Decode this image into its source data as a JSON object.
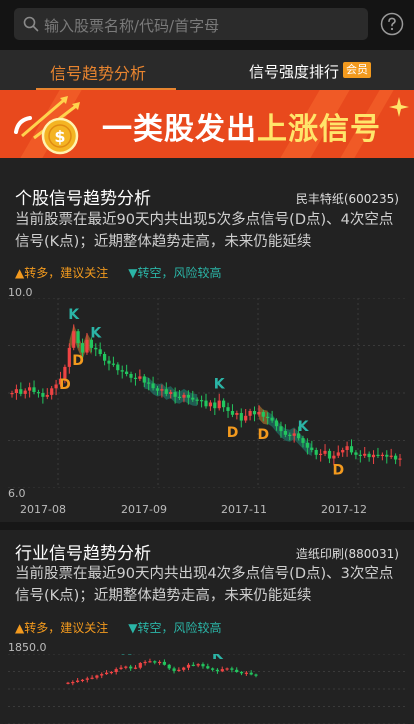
{
  "search": {
    "placeholder": "输入股票名称/代码/首字母",
    "icon": "search-icon"
  },
  "help_icon": "question-circle-icon",
  "tabs": [
    {
      "label": "信号趋势分析",
      "active": true
    },
    {
      "label": "信号强度排行",
      "badge": "会员"
    }
  ],
  "banner": {
    "text_white": "一类股发出",
    "text_highlight": "上涨信号"
  },
  "legend": {
    "up": "转多，建议关注",
    "down": "转空，风险较高"
  },
  "colors": {
    "accent": "#e8842f",
    "bull": "#ef4444",
    "bear": "#22c55e",
    "trend_up": "#c8842f",
    "trend_down": "#1f8a7a",
    "signal_k": "#2bb5a7",
    "signal_d": "#f39a1e"
  },
  "stock_section": {
    "title": "个股信号趋势分析",
    "stock": "民丰特纸(600235)",
    "desc": "当前股票在最近90天内共出现5次多点信号(D点)、4次空点信号(K点)；近期整体趋势走高，未来仍能延续",
    "y_top": "10.0",
    "y_bottom": "6.0",
    "x_labels": [
      "2017-08",
      "2017-09",
      "2017-11",
      "2017-12"
    ]
  },
  "industry_section": {
    "title": "行业信号趋势分析",
    "stock": "造纸印刷(880031)",
    "desc": "当前股票在最近90天内共出现4次多点信号(D点)、3次空点信号(K点)；近期整体趋势走高，未来仍能延续",
    "y_top": "1850.0"
  },
  "chart_data": [
    {
      "type": "candlestick",
      "title": "个股信号趋势分析",
      "ylim": [
        6.0,
        10.0
      ],
      "x_tick_labels": [
        "2017-08",
        "2017-09",
        "2017-11",
        "2017-12"
      ],
      "closes": [
        8.0,
        8.08,
        7.98,
        8.05,
        8.12,
        8.02,
        8.0,
        7.92,
        7.96,
        8.1,
        8.18,
        8.3,
        8.55,
        8.95,
        9.3,
        9.05,
        8.85,
        9.12,
        8.95,
        8.92,
        8.82,
        8.68,
        8.62,
        8.6,
        8.48,
        8.45,
        8.4,
        8.32,
        8.3,
        8.35,
        8.22,
        8.2,
        8.1,
        8.05,
        8.08,
        7.98,
        8.02,
        7.92,
        7.9,
        7.96,
        7.9,
        7.86,
        7.85,
        7.84,
        7.72,
        7.8,
        7.68,
        7.84,
        7.7,
        7.62,
        7.54,
        7.58,
        7.42,
        7.52,
        7.62,
        7.55,
        7.6,
        7.5,
        7.48,
        7.42,
        7.3,
        7.2,
        7.12,
        7.1,
        7.15,
        7.05,
        6.95,
        6.85,
        6.8,
        6.7,
        6.72,
        6.78,
        6.62,
        6.68,
        6.75,
        6.8,
        6.88,
        6.75,
        6.7,
        6.68,
        6.72,
        6.65,
        6.7,
        6.68,
        6.7,
        6.66,
        6.68,
        6.6,
        6.62
      ],
      "signals": [
        {
          "type": "D",
          "index": 12
        },
        {
          "type": "K",
          "index": 14
        },
        {
          "type": "D",
          "index": 15
        },
        {
          "type": "K",
          "index": 19
        },
        {
          "type": "K",
          "index": 47
        },
        {
          "type": "D",
          "index": 50
        },
        {
          "type": "D",
          "index": 57
        },
        {
          "type": "K",
          "index": 66
        },
        {
          "type": "D",
          "index": 74
        }
      ],
      "trend_bands": [
        {
          "direction": "up",
          "from": 13,
          "to": 18
        },
        {
          "direction": "down",
          "from": 30,
          "to": 42
        },
        {
          "direction": "up",
          "from": 56,
          "to": 58
        },
        {
          "direction": "down",
          "from": 58,
          "to": 68
        }
      ]
    },
    {
      "type": "candlestick",
      "title": "行业信号趋势分析",
      "ylim_top": 1850.0,
      "closes": [
        1770,
        1772,
        1776,
        1778,
        1782,
        1784,
        1790,
        1794,
        1798,
        1800,
        1808,
        1812,
        1815,
        1810,
        1812,
        1825,
        1828,
        1830,
        1826,
        1828,
        1820,
        1810,
        1803,
        1806,
        1812,
        1820,
        1818,
        1822,
        1816,
        1810,
        1806,
        1802,
        1808,
        1810,
        1806,
        1800,
        1796,
        1798,
        1793,
        1790
      ],
      "signals": [
        {
          "type": "K",
          "index": 12
        },
        {
          "type": "K",
          "index": 18
        },
        {
          "type": "K",
          "index": 31
        }
      ]
    }
  ]
}
